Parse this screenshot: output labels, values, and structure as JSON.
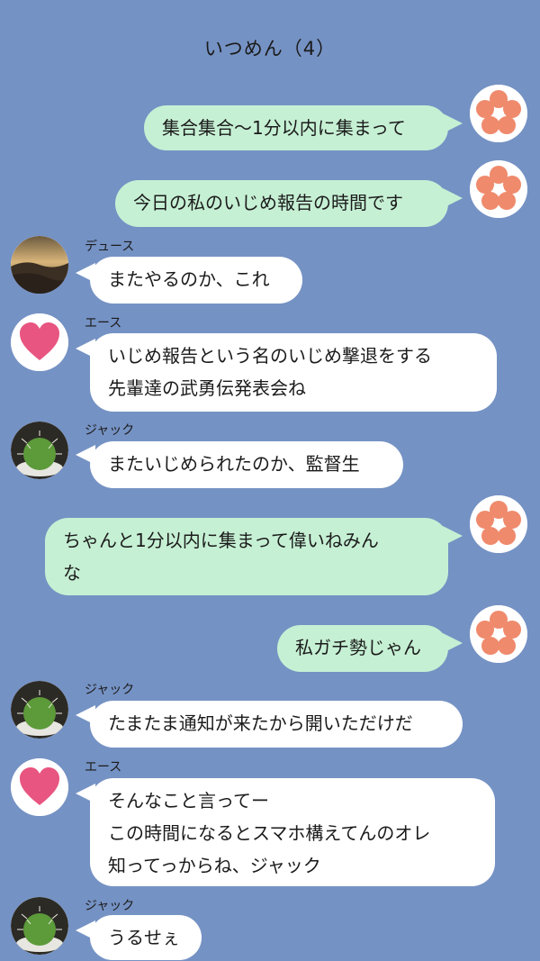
{
  "header": {
    "title": "いつめん（4）"
  },
  "messages": [
    {
      "sender": "",
      "side": "right",
      "avatar": "flower-icon",
      "lines": [
        "集合集合〜1分以内に集まって"
      ]
    },
    {
      "sender": "",
      "side": "right",
      "avatar": "flower-icon",
      "lines": [
        "今日の私のいじめ報告の時間です"
      ]
    },
    {
      "sender": "デュース",
      "side": "left",
      "avatar": "landscape-avatar",
      "lines": [
        "またやるのか、これ"
      ]
    },
    {
      "sender": "エース",
      "side": "left",
      "avatar": "heart-icon",
      "lines": [
        "いじめ報告という名のいじめ撃退をする",
        "先輩達の武勇伝発表会ね"
      ]
    },
    {
      "sender": "ジャック",
      "side": "left",
      "avatar": "cactus-avatar",
      "lines": [
        "またいじめられたのか、監督生"
      ]
    },
    {
      "sender": "",
      "side": "right",
      "avatar": "flower-icon",
      "lines": [
        "ちゃんと1分以内に集まって偉いねみん",
        "な"
      ]
    },
    {
      "sender": "",
      "side": "right",
      "avatar": "flower-icon",
      "lines": [
        "私ガチ勢じゃん"
      ]
    },
    {
      "sender": "ジャック",
      "side": "left",
      "avatar": "cactus-avatar",
      "lines": [
        "たまたま通知が来たから開いただけだ"
      ]
    },
    {
      "sender": "エース",
      "side": "left",
      "avatar": "heart-icon",
      "lines": [
        "そんなこと言ってー",
        "この時間になるとスマホ構えてんのオレ",
        "知ってっからね、ジャック"
      ]
    },
    {
      "sender": "ジャック",
      "side": "left",
      "avatar": "cactus-avatar",
      "lines": [
        "うるせぇ"
      ]
    }
  ],
  "colors": {
    "background": "#7592c4",
    "my_bubble": "#c6f0d4",
    "their_bubble": "#ffffff",
    "flower_petal": "#ef8a6c",
    "heart": "#e85580"
  }
}
